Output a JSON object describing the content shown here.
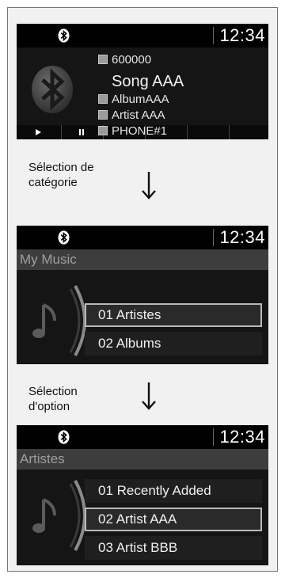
{
  "status_bar": {
    "time": "12:34"
  },
  "screen_now_playing": {
    "track_number": "600000",
    "song": "Song AAA",
    "album": "AlbumAAA",
    "artist": "Artist AAA",
    "source": "PHONE#1"
  },
  "captions": {
    "step1": "Sélection de\ncatégorie",
    "step2": "Sélection\nd'option"
  },
  "screen_category": {
    "header": "My Music",
    "items": [
      {
        "label": "01 Artistes",
        "selected": true
      },
      {
        "label": "02 Albums",
        "selected": false
      }
    ]
  },
  "screen_option": {
    "header": "Artistes",
    "items": [
      {
        "label": "01 Recently Added",
        "selected": false
      },
      {
        "label": "02 Artist AAA",
        "selected": true
      },
      {
        "label": "03 Artist BBB",
        "selected": false
      }
    ]
  },
  "icons": {
    "status": "bluetooth-icon",
    "now_playing_art": "bluetooth-icon",
    "list_art": "music-note-icon"
  },
  "colors": {
    "screen_bg": "#151515",
    "header_bg": "#3d3d3d",
    "selection_border": "#b9b9b9"
  }
}
